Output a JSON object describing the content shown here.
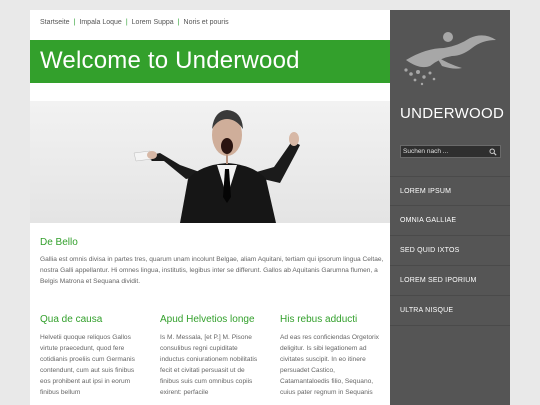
{
  "breadcrumb": [
    "Startseite",
    "Impala Loque",
    "Lorem Suppa",
    "Noris et pouris"
  ],
  "page_title": "Welcome to Underwood",
  "intro": {
    "heading": "De Bello",
    "text": "Gallia est omnis divisa in partes tres, quarum unam incolunt Belgae, aliam Aquitani, tertiam qui ipsorum lingua Celtae, nostra Galli appellantur. Hi omnes lingua, institutis, legibus inter se differunt. Gallos ab Aquitanis Garumna flumen, a Belgis Matrona et Sequana dividit."
  },
  "columns": [
    {
      "heading": "Qua de causa",
      "text": "Helvetii quoque reliquos Gallos virtute praecedunt, quod fere cotidianis proeliis cum Germanis contendunt, cum aut suis finibus eos prohibent aut ipsi in eorum finibus bellum"
    },
    {
      "heading": "Apud Helvetios longe",
      "text": "Is M. Messala, [et P.] M. Pisone consulibus regni cupiditate inductus coniurationem nobilitatis fecit et civitati persuasit ut de finibus suis cum omnibus copiis exirent: perfacile"
    },
    {
      "heading": "His rebus adducti",
      "text": "Ad eas res conficiendas Orgetorix deligitur. Is sibi legationem ad civitates suscipit. In eo itinere persuadet Castico, Catamantaloedis filio, Sequano, cuius pater regnum in Sequanis"
    }
  ],
  "logo": {
    "text": "UNDERWOOD"
  },
  "search": {
    "placeholder": "Suchen nach ..."
  },
  "nav": [
    "LOREM IPSUM",
    "OMNIA GALLIAE",
    "SED QUID IXTOS",
    "LOREM SED IPORIUM",
    "ULTRA NISQUE"
  ],
  "colors": {
    "accent": "#33a02c",
    "sidebar": "#555555",
    "background": "#e9e9e9"
  },
  "icons": {
    "search": "magnifier-icon"
  }
}
